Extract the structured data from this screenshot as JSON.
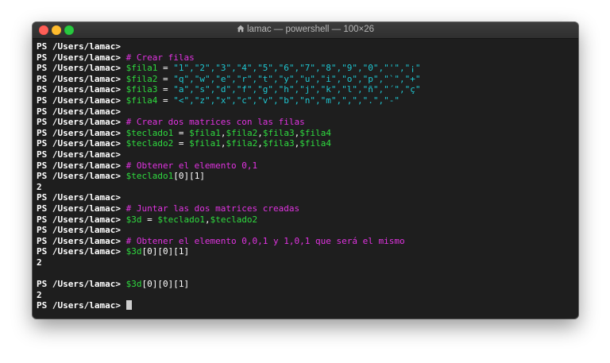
{
  "window": {
    "title": "lamac — powershell — 100×26",
    "title_icon": "home-folder-icon",
    "accent_colors": {
      "comment": "#e033e0",
      "variable": "#2fdb3f",
      "string": "#1fc6d1",
      "text": "#ffffff",
      "background": "#1e1e1e"
    }
  },
  "terminal": {
    "prompt": "PS /Users/lamac> ",
    "lines": [
      {
        "kind": "prompt",
        "segments": []
      },
      {
        "kind": "prompt",
        "segments": [
          {
            "t": "cmt",
            "text": "# Crear filas"
          }
        ]
      },
      {
        "kind": "prompt",
        "segments": [
          {
            "t": "var",
            "text": "$fila1"
          },
          {
            "t": "op",
            "text": " = "
          },
          {
            "t": "str",
            "text": "\"1\",\"2\",\"3\",\"4\",\"5\",\"6\",\"7\",\"8\",\"9\",\"0\",\"'\",\"¡\""
          }
        ]
      },
      {
        "kind": "prompt",
        "segments": [
          {
            "t": "var",
            "text": "$fila2"
          },
          {
            "t": "op",
            "text": " = "
          },
          {
            "t": "str",
            "text": "\"q\",\"w\",\"e\",\"r\",\"t\",\"y\",\"u\",\"i\",\"o\",\"p\",\"`\",\"+\""
          }
        ]
      },
      {
        "kind": "prompt",
        "segments": [
          {
            "t": "var",
            "text": "$fila3"
          },
          {
            "t": "op",
            "text": " = "
          },
          {
            "t": "str",
            "text": "\"a\",\"s\",\"d\",\"f\",\"g\",\"h\",\"j\",\"k\",\"l\",\"ñ\",\"´\",\"ç\""
          }
        ]
      },
      {
        "kind": "prompt",
        "segments": [
          {
            "t": "var",
            "text": "$fila4"
          },
          {
            "t": "op",
            "text": " = "
          },
          {
            "t": "str",
            "text": "\"<\",\"z\",\"x\",\"c\",\"v\",\"b\",\"n\",\"m\",\",\",\".\",\"-\""
          }
        ]
      },
      {
        "kind": "prompt",
        "segments": []
      },
      {
        "kind": "prompt",
        "segments": [
          {
            "t": "cmt",
            "text": "# Crear dos matrices con las filas"
          }
        ]
      },
      {
        "kind": "prompt",
        "segments": [
          {
            "t": "var",
            "text": "$teclado1"
          },
          {
            "t": "op",
            "text": " = "
          },
          {
            "t": "var",
            "text": "$fila1"
          },
          {
            "t": "op",
            "text": ","
          },
          {
            "t": "var",
            "text": "$fila2"
          },
          {
            "t": "op",
            "text": ","
          },
          {
            "t": "var",
            "text": "$fila3"
          },
          {
            "t": "op",
            "text": ","
          },
          {
            "t": "var",
            "text": "$fila4"
          }
        ]
      },
      {
        "kind": "prompt",
        "segments": [
          {
            "t": "var",
            "text": "$teclado2"
          },
          {
            "t": "op",
            "text": " = "
          },
          {
            "t": "var",
            "text": "$fila1"
          },
          {
            "t": "op",
            "text": ","
          },
          {
            "t": "var",
            "text": "$fila2"
          },
          {
            "t": "op",
            "text": ","
          },
          {
            "t": "var",
            "text": "$fila3"
          },
          {
            "t": "op",
            "text": ","
          },
          {
            "t": "var",
            "text": "$fila4"
          }
        ]
      },
      {
        "kind": "prompt",
        "segments": []
      },
      {
        "kind": "prompt",
        "segments": [
          {
            "t": "cmt",
            "text": "# Obtener el elemento 0,1"
          }
        ]
      },
      {
        "kind": "prompt",
        "segments": [
          {
            "t": "var",
            "text": "$teclado1"
          },
          {
            "t": "op",
            "text": "[0][1]"
          }
        ]
      },
      {
        "kind": "output",
        "text": "2"
      },
      {
        "kind": "prompt",
        "segments": []
      },
      {
        "kind": "prompt",
        "segments": [
          {
            "t": "cmt",
            "text": "# Juntar las dos matrices creadas"
          }
        ]
      },
      {
        "kind": "prompt",
        "segments": [
          {
            "t": "var",
            "text": "$3d"
          },
          {
            "t": "op",
            "text": " = "
          },
          {
            "t": "var",
            "text": "$teclado1"
          },
          {
            "t": "op",
            "text": ","
          },
          {
            "t": "var",
            "text": "$teclado2"
          }
        ]
      },
      {
        "kind": "prompt",
        "segments": []
      },
      {
        "kind": "prompt",
        "segments": [
          {
            "t": "cmt",
            "text": "# Obtener el elemento 0,0,1 y 1,0,1 que será el mismo"
          }
        ]
      },
      {
        "kind": "prompt",
        "segments": [
          {
            "t": "var",
            "text": "$3d"
          },
          {
            "t": "op",
            "text": "[0][0][1]"
          }
        ]
      },
      {
        "kind": "output",
        "text": "2"
      },
      {
        "kind": "blank"
      },
      {
        "kind": "prompt",
        "segments": [
          {
            "t": "var",
            "text": "$3d"
          },
          {
            "t": "op",
            "text": "[0][0][1]"
          }
        ]
      },
      {
        "kind": "output",
        "text": "2"
      },
      {
        "kind": "prompt",
        "segments": [],
        "cursor": true
      }
    ]
  }
}
